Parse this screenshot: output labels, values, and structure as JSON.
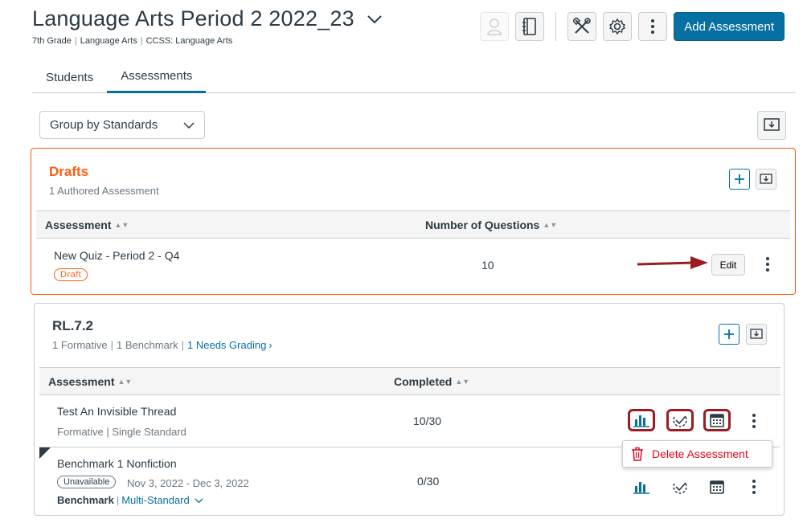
{
  "header": {
    "title": "Language Arts Period 2 2022_23",
    "grade": "7th Grade",
    "subject": "Language Arts",
    "standard_set": "CCSS: Language Arts",
    "add_assessment_label": "Add Assessment"
  },
  "tabs": [
    {
      "label": "Students",
      "active": false
    },
    {
      "label": "Assessments",
      "active": true
    }
  ],
  "group_select": {
    "value": "Group by Standards"
  },
  "drafts": {
    "title": "Drafts",
    "subtitle": "1 Authored Assessment",
    "columns": [
      "Assessment",
      "Number of Questions"
    ],
    "rows": [
      {
        "name": "New Quiz - Period 2 - Q4",
        "badge": "Draft",
        "questions": "10",
        "edit_label": "Edit"
      }
    ]
  },
  "standard": {
    "title": "RL.7.2",
    "formative": "1 Formative",
    "benchmark": "1 Benchmark",
    "needs_grading": "1 Needs Grading",
    "columns": [
      "Assessment",
      "Completed"
    ],
    "rows": [
      {
        "name": "Test An Invisible Thread",
        "meta": "Formative | Single Standard",
        "completed": "10/30"
      },
      {
        "name": "Benchmark 1 Nonfiction",
        "status": "Unavailable",
        "dates": "Nov 3, 2022 - Dec 3, 2022",
        "type": "Benchmark",
        "multi": "Multi-Standard",
        "completed": "0/30"
      }
    ]
  },
  "menu": {
    "delete_label": "Delete Assessment"
  },
  "colors": {
    "primary": "#0770a3",
    "drafts_accent": "#fc5e13",
    "danger": "#e0061f",
    "highlight": "#9b1c23"
  }
}
